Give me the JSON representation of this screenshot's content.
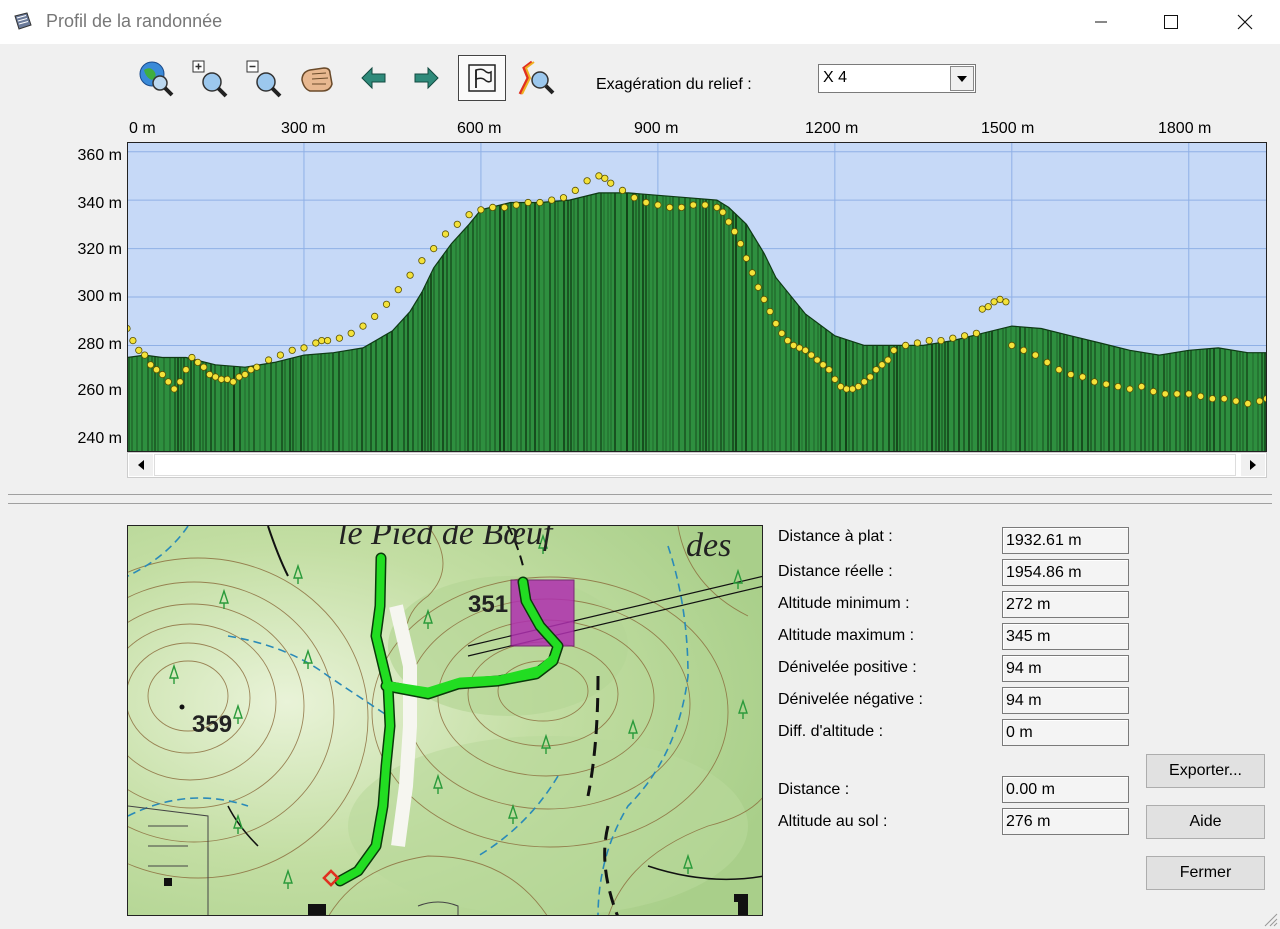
{
  "window": {
    "title": "Profil de la randonnée",
    "controls": {
      "minimize": "—",
      "maximize": "☐",
      "close": "✕"
    }
  },
  "toolbar": {
    "buttons": [
      {
        "name": "globe-zoom-icon"
      },
      {
        "name": "zoom-in-icon"
      },
      {
        "name": "zoom-out-icon"
      },
      {
        "name": "pan-hand-icon"
      },
      {
        "name": "arrow-left-icon"
      },
      {
        "name": "arrow-right-icon"
      },
      {
        "name": "flag-icon",
        "active": true
      },
      {
        "name": "route-zoom-icon"
      }
    ],
    "relief_label": "Exagération du relief :",
    "relief_value": "X 4"
  },
  "chart_data": {
    "type": "area",
    "x_ticks": [
      "0 m",
      "300 m",
      "600 m",
      "900 m",
      "1200 m",
      "1500 m",
      "1800 m"
    ],
    "y_ticks": [
      "360 m",
      "340 m",
      "320 m",
      "300 m",
      "280 m",
      "260 m",
      "240 m"
    ],
    "xlim": [
      0,
      1932.61
    ],
    "ylim": [
      236,
      364
    ],
    "grid": true,
    "terrain": {
      "x": [
        0,
        30,
        60,
        100,
        150,
        200,
        250,
        300,
        350,
        400,
        450,
        480,
        500,
        520,
        550,
        580,
        600,
        650,
        700,
        750,
        800,
        850,
        900,
        950,
        1000,
        1020,
        1050,
        1080,
        1100,
        1150,
        1200,
        1250,
        1300,
        1350,
        1400,
        1450,
        1500,
        1550,
        1600,
        1650,
        1700,
        1750,
        1800,
        1850,
        1900,
        1932
      ],
      "y": [
        275,
        276,
        275,
        275,
        272,
        271,
        273,
        276,
        277,
        279,
        286,
        294,
        302,
        312,
        322,
        330,
        336,
        339,
        339,
        340,
        343,
        343,
        342,
        341,
        340,
        337,
        330,
        318,
        308,
        293,
        284,
        280,
        280,
        280,
        282,
        285,
        288,
        287,
        284,
        281,
        278,
        276,
        278,
        279,
        277,
        277
      ]
    },
    "gps_points": {
      "x": [
        0,
        10,
        20,
        30,
        40,
        50,
        60,
        70,
        80,
        90,
        100,
        110,
        120,
        130,
        140,
        150,
        160,
        170,
        180,
        190,
        200,
        210,
        220,
        240,
        260,
        280,
        300,
        320,
        330,
        340,
        360,
        380,
        400,
        420,
        440,
        460,
        480,
        500,
        520,
        540,
        560,
        580,
        600,
        620,
        640,
        660,
        680,
        700,
        720,
        740,
        760,
        780,
        800,
        810,
        820,
        840,
        860,
        880,
        900,
        920,
        940,
        960,
        980,
        1000,
        1010,
        1020,
        1030,
        1040,
        1050,
        1060,
        1070,
        1080,
        1090,
        1100,
        1110,
        1120,
        1130,
        1140,
        1150,
        1160,
        1170,
        1180,
        1190,
        1200,
        1210,
        1220,
        1230,
        1240,
        1250,
        1260,
        1270,
        1280,
        1290,
        1300,
        1320,
        1340,
        1360,
        1380,
        1400,
        1420,
        1440,
        1450,
        1460,
        1470,
        1480,
        1490,
        1500,
        1520,
        1540,
        1560,
        1580,
        1600,
        1620,
        1640,
        1660,
        1680,
        1700,
        1720,
        1740,
        1760,
        1780,
        1800,
        1820,
        1840,
        1860,
        1880,
        1900,
        1920,
        1932
      ],
      "y": [
        287,
        282,
        278,
        276,
        272,
        270,
        268,
        265,
        262,
        265,
        270,
        275,
        273,
        271,
        268,
        267,
        266,
        266,
        265,
        267,
        268,
        270,
        271,
        274,
        276,
        278,
        279,
        281,
        282,
        282,
        283,
        285,
        288,
        292,
        297,
        303,
        309,
        315,
        320,
        326,
        330,
        334,
        336,
        337,
        337,
        338,
        339,
        339,
        340,
        341,
        344,
        348,
        350,
        349,
        347,
        344,
        341,
        339,
        338,
        337,
        337,
        338,
        338,
        337,
        335,
        331,
        327,
        322,
        316,
        310,
        304,
        299,
        294,
        289,
        285,
        282,
        280,
        279,
        278,
        276,
        274,
        272,
        270,
        266,
        263,
        262,
        262,
        263,
        265,
        267,
        270,
        272,
        274,
        278,
        280,
        281,
        282,
        282,
        283,
        284,
        285,
        295,
        296,
        298,
        299,
        298,
        280,
        278,
        276,
        273,
        270,
        268,
        267,
        265,
        264,
        263,
        262,
        263,
        261,
        260,
        260,
        260,
        259,
        258,
        258,
        257,
        256,
        257,
        258
      ]
    }
  },
  "stats": {
    "distance_plat": {
      "label": "Distance à plat :",
      "value": "1932.61 m"
    },
    "distance_reelle": {
      "label": "Distance réelle :",
      "value": "1954.86 m"
    },
    "alt_min": {
      "label": "Altitude minimum :",
      "value": "272 m"
    },
    "alt_max": {
      "label": "Altitude maximum :",
      "value": "345 m"
    },
    "den_pos": {
      "label": "Dénivelée positive :",
      "value": "94 m"
    },
    "den_neg": {
      "label": "Dénivelée négative :",
      "value": "94 m"
    },
    "diff_alt": {
      "label": "Diff. d'altitude :",
      "value": "0 m"
    },
    "distance": {
      "label": "Distance :",
      "value": "0.00 m"
    },
    "alt_sol": {
      "label": "Altitude au sol :",
      "value": "276 m"
    }
  },
  "buttons": {
    "export": "Exporter...",
    "help": "Aide",
    "close": "Fermer"
  },
  "map": {
    "labels": {
      "top_place": "le Pied de Bœuf",
      "top_right": "des",
      "peak_351": "351",
      "peak_359": "359"
    },
    "track_color": "#22dd22",
    "building_color": "#b030b0"
  }
}
